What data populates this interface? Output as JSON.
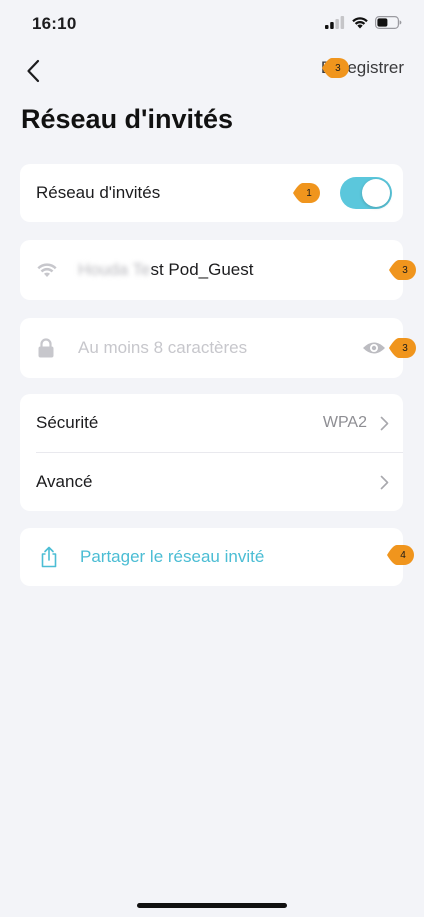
{
  "status_bar": {
    "time": "16:10"
  },
  "nav": {
    "save_label": "Enregistrer"
  },
  "page": {
    "title": "Réseau d'invités"
  },
  "guest_network": {
    "label": "Réseau d'invités",
    "enabled": true
  },
  "ssid": {
    "hidden_part": "Houda Te",
    "visible_part": "st Pod_Guest"
  },
  "password": {
    "placeholder": "Au moins 8 caractères",
    "value": ""
  },
  "settings": [
    {
      "label": "Sécurité",
      "value": "WPA2"
    },
    {
      "label": "Avancé",
      "value": ""
    }
  ],
  "share": {
    "label": "Partager le réseau invité"
  },
  "markers": {
    "save": "3",
    "toggle": "1",
    "ssid": "3",
    "password": "3",
    "share": "4"
  },
  "colors": {
    "accent": "#5bc7dc",
    "link": "#4bbdd4",
    "marker": "#f0951d",
    "background": "#f3f4f8"
  }
}
